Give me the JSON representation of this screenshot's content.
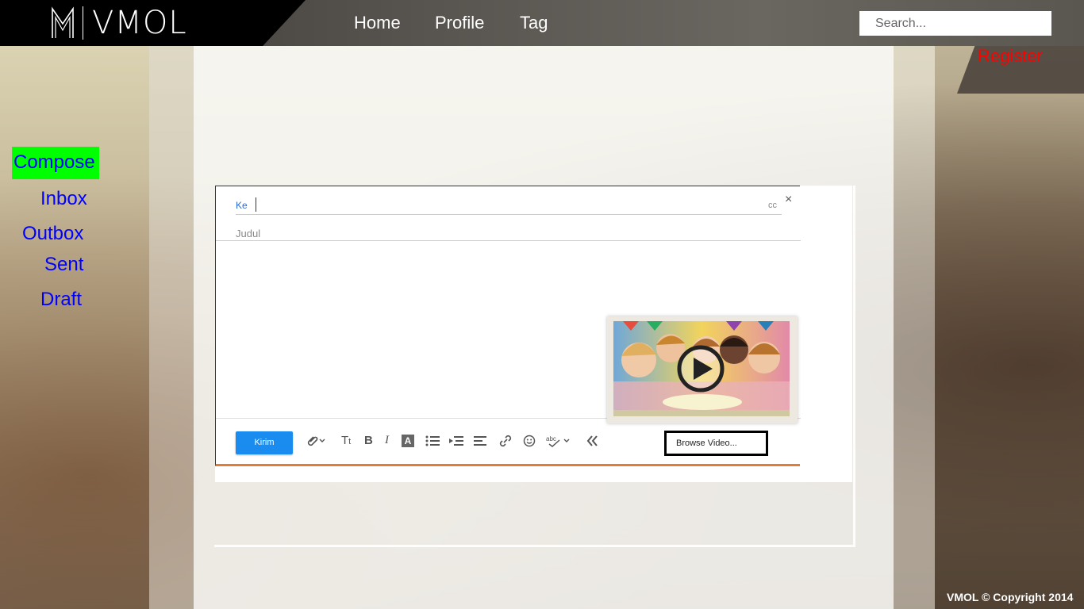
{
  "header": {
    "logo_text": "VMOL",
    "nav": {
      "home": "Home",
      "profile": "Profile",
      "tag": "Tag"
    },
    "search": {
      "placeholder": "Search..."
    },
    "register": "Register"
  },
  "sidebar": {
    "items": [
      {
        "label": "Compose",
        "active": true
      },
      {
        "label": "Inbox"
      },
      {
        "label": "Outbox"
      },
      {
        "label": "Sent"
      },
      {
        "label": "Draft"
      }
    ]
  },
  "compose": {
    "to_label": "Ke",
    "cc_label": "cc",
    "close_symbol": "×",
    "subject_placeholder": "Judul",
    "send_label": "Kirim",
    "browse_label": "Browse Video...",
    "toolbar_icons": [
      "attachment-icon",
      "text-size-icon",
      "bold-icon",
      "italic-icon",
      "text-color-icon",
      "bullet-list-icon",
      "indent-icon",
      "align-icon",
      "link-icon",
      "emoji-icon",
      "spellcheck-icon",
      "collapse-icon"
    ]
  },
  "footer": {
    "copyright": "VMOL © Copyright 2014"
  },
  "colors": {
    "active_bg": "#00ff00",
    "link": "#0000ff",
    "register": "#ff0000",
    "send_button": "#1a8cf0"
  }
}
